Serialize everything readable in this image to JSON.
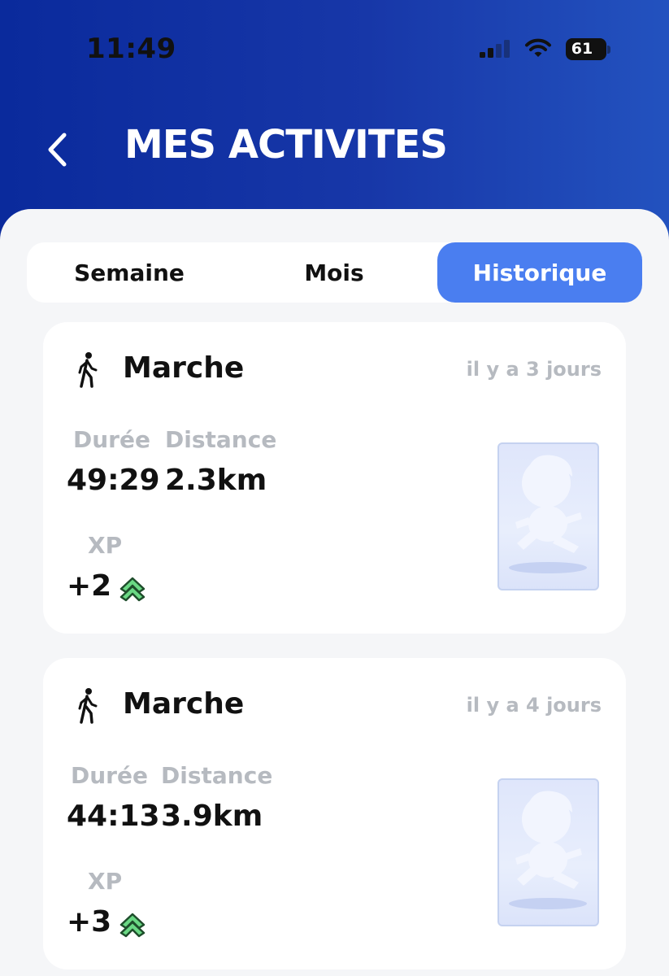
{
  "status_bar": {
    "time": "11:49",
    "battery": "61"
  },
  "header": {
    "title": "MES ACTIVITES"
  },
  "tabs": [
    {
      "label": "Semaine",
      "active": false
    },
    {
      "label": "Mois",
      "active": false
    },
    {
      "label": "Historique",
      "active": true
    }
  ],
  "activities": [
    {
      "icon": "walking-person-icon",
      "name": "Marche",
      "time_ago": "il y a 3 jours",
      "duration_label": "Durée",
      "duration": "49:29",
      "distance_label": "Distance",
      "distance": "2.3km",
      "xp_label": "XP",
      "xp": "+2",
      "xp_icon": "double-chevron-up-icon"
    },
    {
      "icon": "walking-person-icon",
      "name": "Marche",
      "time_ago": "il y a 4 jours",
      "duration_label": "Durée",
      "duration": "44:13",
      "distance_label": "Distance",
      "distance": "3.9km",
      "xp_label": "XP",
      "xp": "+3",
      "xp_icon": "double-chevron-up-icon"
    }
  ],
  "colors": {
    "header_start": "#0a2a9c",
    "header_end": "#2352bf",
    "tab_active": "#4a7ef0",
    "muted_text": "#b6bac0",
    "xp_green": "#5fd27a"
  }
}
